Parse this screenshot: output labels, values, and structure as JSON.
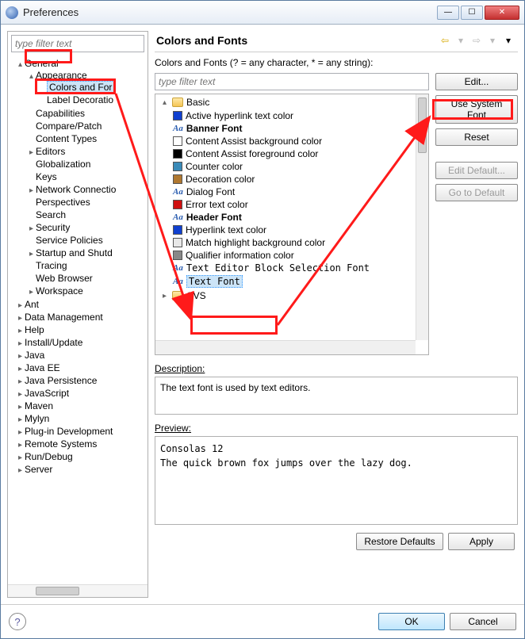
{
  "window": {
    "title": "Preferences"
  },
  "left": {
    "filter_placeholder": "type filter text",
    "tree": {
      "general": "General",
      "appearance": "Appearance",
      "colors_and_fonts": "Colors and For",
      "label_decorations": "Label Decoratio",
      "capabilities": "Capabilities",
      "compare_patch": "Compare/Patch",
      "content_types": "Content Types",
      "editors": "Editors",
      "globalization": "Globalization",
      "keys": "Keys",
      "network_connections": "Network Connectio",
      "perspectives": "Perspectives",
      "search": "Search",
      "security": "Security",
      "service_policies": "Service Policies",
      "startup_shutdown": "Startup and Shutd",
      "tracing": "Tracing",
      "web_browser": "Web Browser",
      "workspace": "Workspace",
      "ant": "Ant",
      "data_management": "Data Management",
      "help": "Help",
      "install_update": "Install/Update",
      "java": "Java",
      "java_ee": "Java EE",
      "java_persistence": "Java Persistence",
      "javascript": "JavaScript",
      "maven": "Maven",
      "mylyn": "Mylyn",
      "plugin_dev": "Plug-in Development",
      "remote_systems": "Remote Systems",
      "run_debug": "Run/Debug",
      "server": "Server"
    }
  },
  "right": {
    "heading": "Colors and Fonts",
    "hint": "Colors and Fonts (? = any character, * = any string):",
    "filter_placeholder": "type filter text",
    "basic": "Basic",
    "items": {
      "active_hyperlink": "Active hyperlink text color",
      "banner_font": "Banner Font",
      "ca_bg": "Content Assist background color",
      "ca_fg": "Content Assist foreground color",
      "counter": "Counter color",
      "decoration": "Decoration color",
      "dialog_font": "Dialog Font",
      "error": "Error text color",
      "header_font": "Header Font",
      "hyperlink": "Hyperlink text color",
      "match_hl": "Match highlight background color",
      "qualifier": "Qualifier information color",
      "block_sel_font": "Text Editor Block Selection Font",
      "text_font": "Text Font"
    },
    "cvs": "CVS",
    "colors": {
      "active_hyperlink": "#1040d0",
      "ca_bg": "#ffffff",
      "ca_fg": "#000000",
      "counter": "#3a8ab8",
      "decoration": "#b07830",
      "error": "#d01010",
      "hyperlink": "#1040d0",
      "match_hl": "#e8e8e8",
      "qualifier": "#888888"
    },
    "buttons": {
      "edit": "Edit...",
      "use_system": "Use System Font",
      "reset": "Reset",
      "edit_default": "Edit Default...",
      "goto_default": "Go to Default"
    },
    "desc_label": "Description:",
    "desc_text": "The text font is used by text editors.",
    "preview_label": "Preview:",
    "preview_line1": "Consolas 12",
    "preview_line2": "The quick brown fox jumps over the lazy dog.",
    "restore_defaults": "Restore Defaults",
    "apply": "Apply"
  },
  "bottom": {
    "ok": "OK",
    "cancel": "Cancel"
  }
}
